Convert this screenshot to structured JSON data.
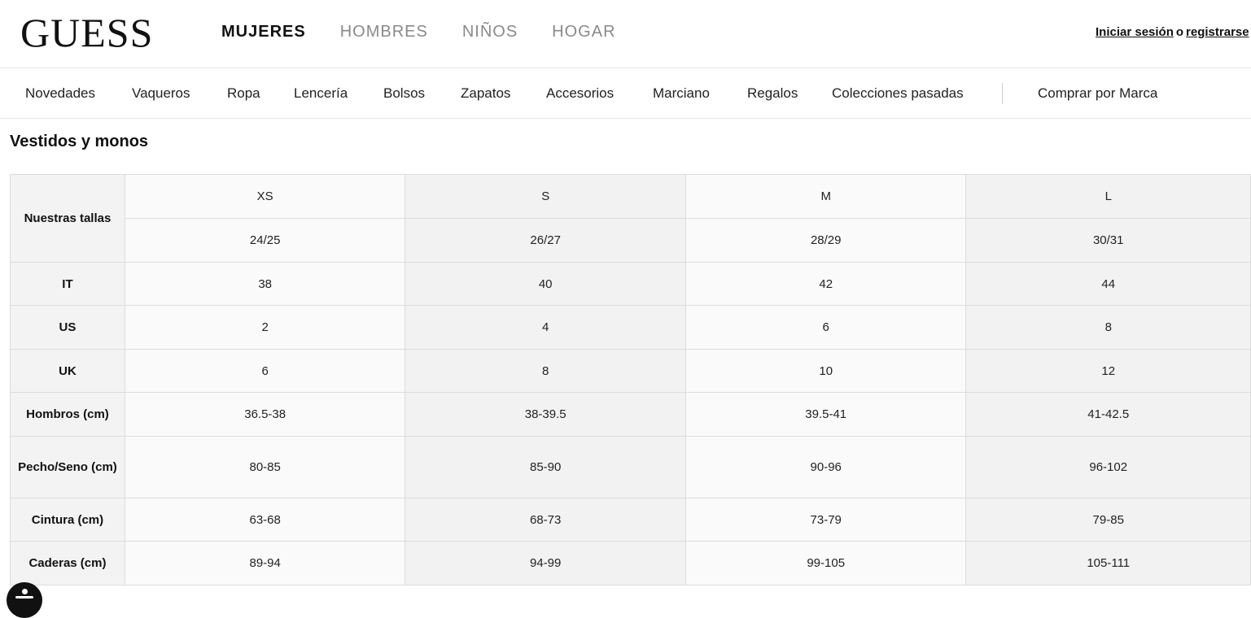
{
  "brand": {
    "logo_text": "GUESS"
  },
  "top_nav": [
    {
      "label": "MUJERES",
      "active": true
    },
    {
      "label": "HOMBRES",
      "active": false
    },
    {
      "label": "NIÑOS",
      "active": false
    },
    {
      "label": "HOGAR",
      "active": false
    }
  ],
  "auth": {
    "login_label": "Iniciar sesión",
    "or_label": "o",
    "register_label": "registrarse"
  },
  "sub_nav": [
    {
      "label": "Novedades"
    },
    {
      "label": "Vaqueros"
    },
    {
      "label": "Ropa"
    },
    {
      "label": "Lencería"
    },
    {
      "label": "Bolsos"
    },
    {
      "label": "Zapatos"
    },
    {
      "label": "Accesorios"
    },
    {
      "label": "Marciano"
    },
    {
      "label": "Regalos"
    },
    {
      "label": "Colecciones pasadas"
    },
    {
      "label": "Comprar por Marca"
    }
  ],
  "page_title": "Vestidos y monos",
  "size_table": {
    "row_header_label": "Nuestras tallas",
    "sizes": [
      "XS",
      "S",
      "M",
      "L"
    ],
    "waist_sizes": [
      "24/25",
      "26/27",
      "28/29",
      "30/31"
    ],
    "rows": [
      {
        "label": "IT",
        "values": [
          "38",
          "40",
          "42",
          "44"
        ]
      },
      {
        "label": "US",
        "values": [
          "2",
          "4",
          "6",
          "8"
        ]
      },
      {
        "label": "UK",
        "values": [
          "6",
          "8",
          "10",
          "12"
        ]
      },
      {
        "label": "Hombros (cm)",
        "values": [
          "36.5-38",
          "38-39.5",
          "39.5-41",
          "41-42.5"
        ]
      },
      {
        "label": "Pecho/Seno (cm)",
        "values": [
          "80-85",
          "85-90",
          "90-96",
          "96-102"
        ]
      },
      {
        "label": "Cintura (cm)",
        "values": [
          "63-68",
          "68-73",
          "73-79",
          "79-85"
        ]
      },
      {
        "label": "Caderas (cm)",
        "values": [
          "89-94",
          "94-99",
          "99-105",
          "105-111"
        ]
      }
    ]
  },
  "accessibility": {
    "icon": "accessibility-icon"
  },
  "colors": {
    "text": "#111111",
    "muted_nav": "#8a8a8a",
    "border": "#dcdcdc",
    "row_header_bg": "#f3f3f3"
  }
}
